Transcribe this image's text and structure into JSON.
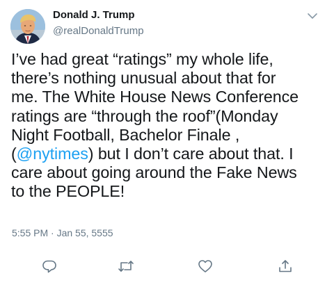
{
  "author": {
    "display_name": "Donald J. Trump",
    "handle": "@realDonaldTrump"
  },
  "tweet": {
    "line1": "I’ve had great “ratings” my whole life,",
    "line2": "there’s nothing unusual about that for",
    "line3": "me. The White House News Conference",
    "line4": "ratings are “through the roof”(Monday",
    "line5": "Night Football, Bachelor Finale ,",
    "line6_mention": "@nytimes",
    "line6_rest": ") but I don’t care about that. I",
    "line7": "care about going around the Fake News",
    "line8": "to the PEOPLE!",
    "line6_open": "("
  },
  "meta": {
    "timestamp": "5:55 PM · Jan 55, 5555"
  },
  "icons": {
    "menu": "chevron-down-icon",
    "reply": "reply-icon",
    "retweet": "retweet-icon",
    "like": "heart-icon",
    "share": "share-icon"
  },
  "colors": {
    "link": "#1da1f2",
    "secondary_text": "#657786",
    "primary_text": "#14171a"
  }
}
